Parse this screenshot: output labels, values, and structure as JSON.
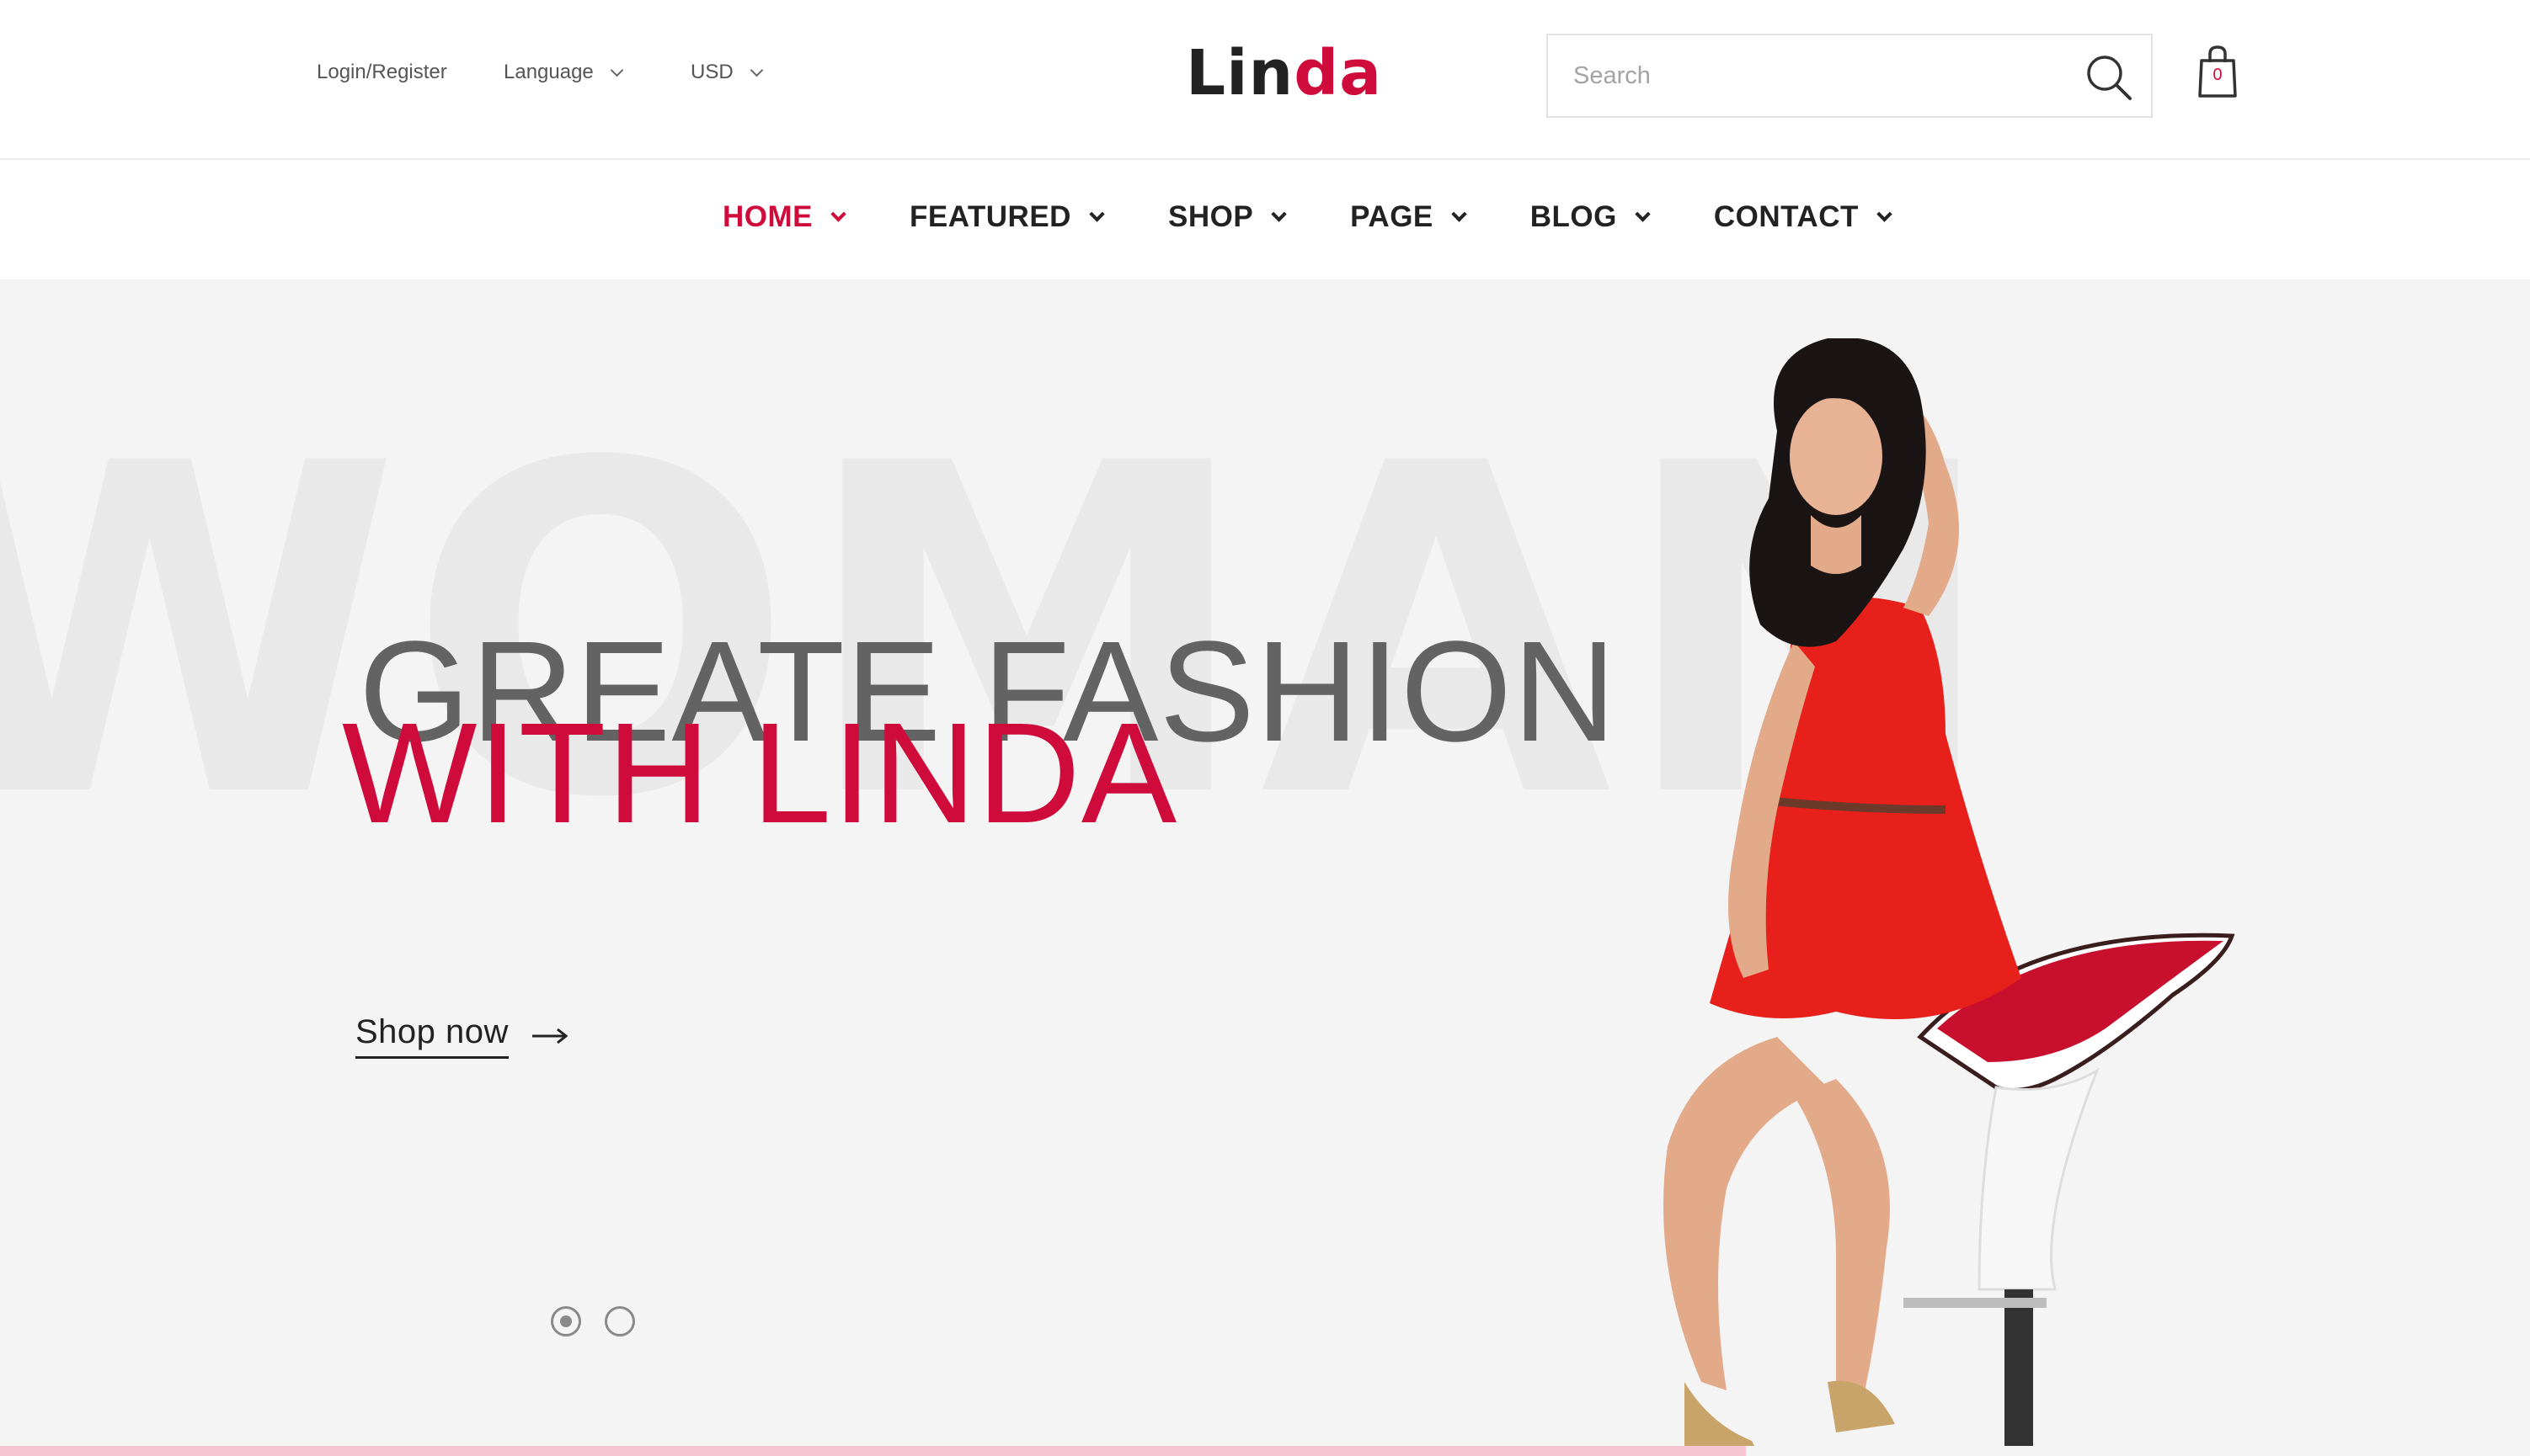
{
  "header": {
    "login_register": "Login/Register",
    "language": "Language",
    "currency": "USD",
    "logo_part1": "Lin",
    "logo_part2": "da",
    "search_placeholder": "Search",
    "cart_count": "0"
  },
  "nav": {
    "items": [
      {
        "label": "HOME",
        "active": true
      },
      {
        "label": "FEATURED",
        "active": false
      },
      {
        "label": "SHOP",
        "active": false
      },
      {
        "label": "PAGE",
        "active": false
      },
      {
        "label": "BLOG",
        "active": false
      },
      {
        "label": "CONTACT",
        "active": false
      }
    ]
  },
  "hero": {
    "watermark": "WOMAN",
    "headline_line1": "GREATE FASHION",
    "headline_line2": "WITH LINDA",
    "cta_label": "Shop now",
    "slide_count": 2,
    "active_slide": 1,
    "slide_progress_fraction": 0.69
  },
  "icons": {
    "search": "search-icon",
    "cart": "shopping-bag-icon",
    "cta_arrow": "arrow-right-icon",
    "dropdown": "chevron-down-icon"
  },
  "colors": {
    "accent": "#cf0b3b",
    "text_dark": "#222222",
    "headline_gray": "#636363",
    "hero_bg": "#f4f4f4",
    "progress": "#f5c6d1"
  }
}
